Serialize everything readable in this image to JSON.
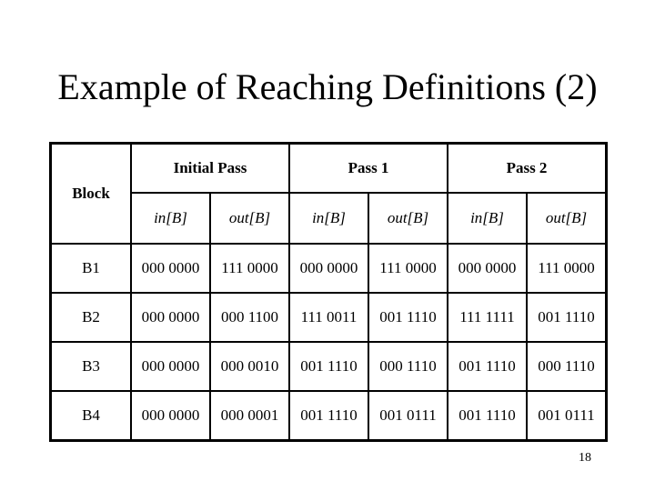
{
  "title": "Example of Reaching Definitions (2)",
  "table": {
    "block_header": "Block",
    "passes": [
      "Initial Pass",
      "Pass 1",
      "Pass 2"
    ],
    "sub_headers": [
      "in[B]",
      "out[B]",
      "in[B]",
      "out[B]",
      "in[B]",
      "out[B]"
    ],
    "rows": [
      {
        "block": "B1",
        "values": [
          "000 0000",
          "111 0000",
          "000 0000",
          "111 0000",
          "000 0000",
          "111 0000"
        ]
      },
      {
        "block": "B2",
        "values": [
          "000 0000",
          "000 1100",
          "111 0011",
          "001 1110",
          "111 1111",
          "001 1110"
        ]
      },
      {
        "block": "B3",
        "values": [
          "000 0000",
          "000 0010",
          "001 1110",
          "000 1110",
          "001 1110",
          "000 1110"
        ]
      },
      {
        "block": "B4",
        "values": [
          "000 0000",
          "000 0001",
          "001 1110",
          "001 0111",
          "001 1110",
          "001 0111"
        ]
      }
    ]
  },
  "page_number": "18"
}
